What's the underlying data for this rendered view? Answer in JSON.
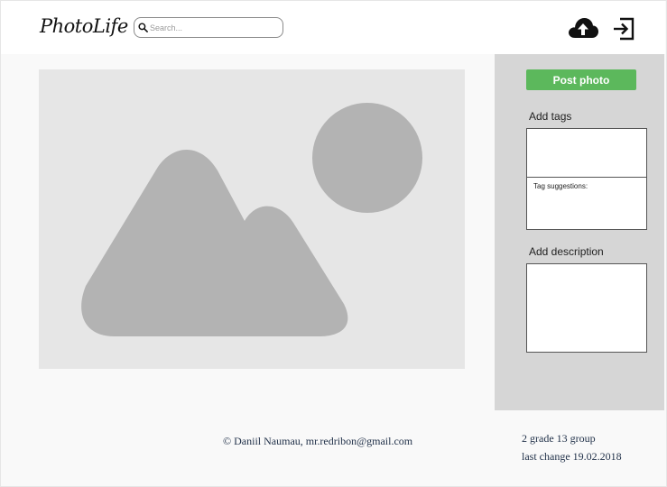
{
  "header": {
    "logo": "PhotoLife",
    "search": {
      "placeholder": "Search..."
    },
    "icons": {
      "upload": "cloud-upload-icon",
      "logout": "logout-icon"
    }
  },
  "main": {
    "photo": {
      "icon": "image-placeholder-icon"
    }
  },
  "sidebar": {
    "post_button": "Post photo",
    "tags_label": "Add tags",
    "tag_suggestions_label": "Tag suggestions:",
    "description_label": "Add description"
  },
  "footer": {
    "copyright": "© Daniil Naumau, mr.redribon@gmail.com",
    "group": "2 grade 13 group",
    "last_change": "last change 19.02.2018"
  },
  "colors": {
    "accent": "#5cb85c",
    "panel": "#d6d6d6",
    "placeholder_bg": "#e6e6e6",
    "placeholder_shape": "#b3b3b3"
  }
}
